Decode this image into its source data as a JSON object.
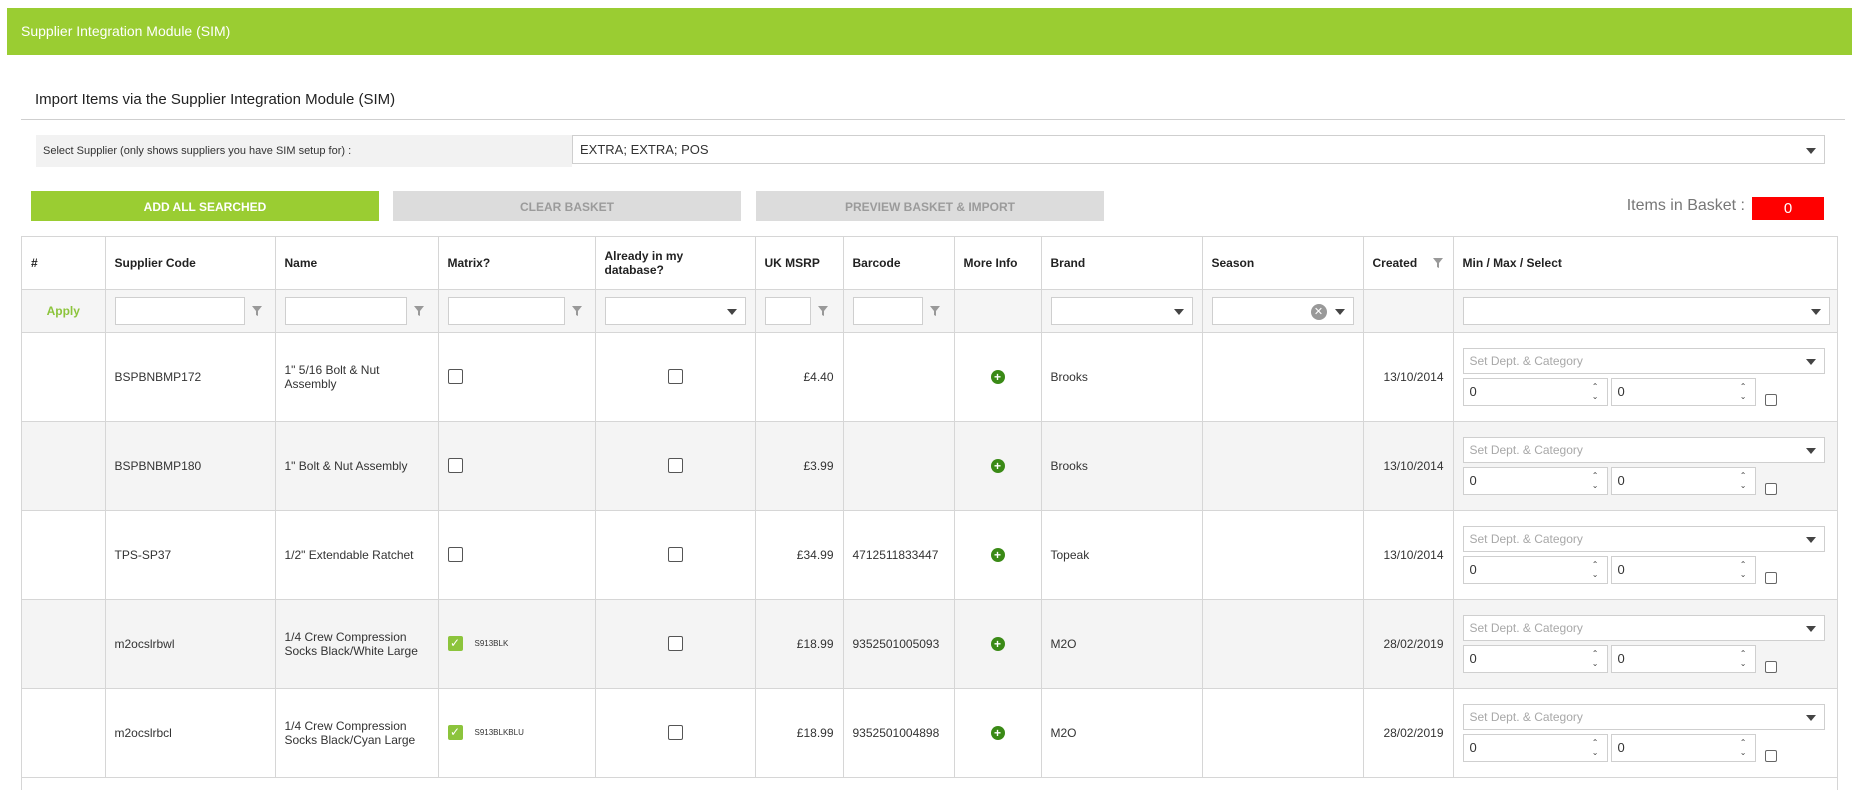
{
  "header": {
    "title": "Supplier Integration Module (SIM)"
  },
  "section": {
    "title": "Import Items via the Supplier Integration Module (SIM)"
  },
  "supplier": {
    "label": "Select Supplier (only shows suppliers you have SIM setup for) :",
    "value": "EXTRA; EXTRA; POS"
  },
  "actions": {
    "add_all": "ADD ALL SEARCHED",
    "clear_basket": "CLEAR BASKET",
    "preview": "PREVIEW BASKET & IMPORT"
  },
  "basket": {
    "label": "Items in Basket :",
    "count": "0"
  },
  "columns": [
    "#",
    "Supplier Code",
    "Name",
    "Matrix?",
    "Already in my database?",
    "UK MSRP",
    "Barcode",
    "More Info",
    "Brand",
    "Season",
    "Created",
    "Min / Max / Select"
  ],
  "filters": {
    "apply": "Apply",
    "clear_symbol": "✕"
  },
  "icons": {
    "filter": "funnel-icon",
    "dropdown": "chevron-down-icon",
    "more_info": "plus-circle-icon",
    "spinner": "up-down-arrows-icon"
  },
  "colors": {
    "brand": "#9acd32",
    "badge": "#ff0000",
    "info_icon": "#3a8a16",
    "checked": "#8cc43c"
  },
  "rows": [
    {
      "code": "BSPBNBMP172",
      "name": "1\" 5/16 Bolt & Nut Assembly",
      "matrix": false,
      "matrix_code": "",
      "in_db": false,
      "msrp": "£4.40",
      "barcode": "",
      "brand": "Brooks",
      "season": "",
      "created": "13/10/2014",
      "dept_placeholder": "Set Dept. & Category",
      "min": "0",
      "max": "0"
    },
    {
      "code": "BSPBNBMP180",
      "name": "1\" Bolt & Nut Assembly",
      "matrix": false,
      "matrix_code": "",
      "in_db": false,
      "msrp": "£3.99",
      "barcode": "",
      "brand": "Brooks",
      "season": "",
      "created": "13/10/2014",
      "dept_placeholder": "Set Dept. & Category",
      "min": "0",
      "max": "0"
    },
    {
      "code": "TPS-SP37",
      "name": "1/2\" Extendable Ratchet",
      "matrix": false,
      "matrix_code": "",
      "in_db": false,
      "msrp": "£34.99",
      "barcode": "4712511833447",
      "brand": "Topeak",
      "season": "",
      "created": "13/10/2014",
      "dept_placeholder": "Set Dept. & Category",
      "min": "0",
      "max": "0"
    },
    {
      "code": "m2ocslrbwl",
      "name": "1/4 Crew Compression Socks Black/White Large",
      "matrix": true,
      "matrix_code": "S913BLK",
      "in_db": false,
      "msrp": "£18.99",
      "barcode": "9352501005093",
      "brand": "M2O",
      "season": "",
      "created": "28/02/2019",
      "dept_placeholder": "Set Dept. & Category",
      "min": "0",
      "max": "0"
    },
    {
      "code": "m2ocslrbcl",
      "name": "1/4 Crew Compression Socks Black/Cyan Large",
      "matrix": true,
      "matrix_code": "S913BLKBLU",
      "in_db": false,
      "msrp": "£18.99",
      "barcode": "9352501004898",
      "brand": "M2O",
      "season": "",
      "created": "28/02/2019",
      "dept_placeholder": "Set Dept. & Category",
      "min": "0",
      "max": "0"
    }
  ]
}
